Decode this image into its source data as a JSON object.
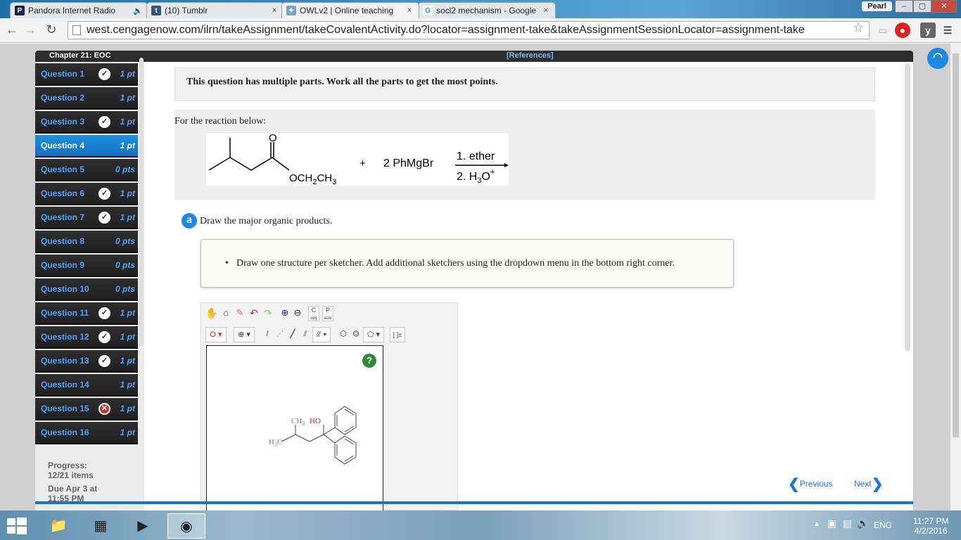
{
  "browser": {
    "tabs": [
      {
        "title": "Pandora Internet Radio",
        "icon": "P",
        "close": "×"
      },
      {
        "title": "(10) Tumblr",
        "icon": "t",
        "close": "×"
      },
      {
        "title": "OWLv2 | Online teaching",
        "icon": "owl",
        "close": "×"
      },
      {
        "title": "socl2 mechanism - Google",
        "icon": "G",
        "close": "×"
      }
    ],
    "profile": "Pearl",
    "url": "west.cengagenow.com/ilrn/takeAssignment/takeCovalentActivity.do?locator=assignment-take&takeAssignmentSessionLocator=assignment-take",
    "window_buttons": [
      "–",
      "▢",
      "✕"
    ]
  },
  "assignment": {
    "chapter": "Chapter 21: EOC",
    "references": "[References]",
    "questions": [
      {
        "label": "Question 1",
        "points": "1 pt",
        "status": "correct"
      },
      {
        "label": "Question 2",
        "points": "1 pt",
        "status": "none"
      },
      {
        "label": "Question 3",
        "points": "1 pt",
        "status": "correct"
      },
      {
        "label": "Question 4",
        "points": "1 pt",
        "status": "active"
      },
      {
        "label": "Question 5",
        "points": "0 pts",
        "status": "none"
      },
      {
        "label": "Question 6",
        "points": "1 pt",
        "status": "correct"
      },
      {
        "label": "Question 7",
        "points": "1 pt",
        "status": "correct"
      },
      {
        "label": "Question 8",
        "points": "0 pts",
        "status": "none"
      },
      {
        "label": "Question 9",
        "points": "0 pts",
        "status": "none"
      },
      {
        "label": "Question 10",
        "points": "0 pts",
        "status": "none"
      },
      {
        "label": "Question 11",
        "points": "1 pt",
        "status": "correct"
      },
      {
        "label": "Question 12",
        "points": "1 pt",
        "status": "correct"
      },
      {
        "label": "Question 13",
        "points": "1 pt",
        "status": "correct"
      },
      {
        "label": "Question 14",
        "points": "1 pt",
        "status": "none"
      },
      {
        "label": "Question 15",
        "points": "1 pt",
        "status": "incorrect"
      },
      {
        "label": "Question 16",
        "points": "1 pt",
        "status": "none"
      }
    ],
    "progress_label": "Progress:",
    "progress_value": "12/21 items",
    "due_line1": "Due Apr 3 at",
    "due_line2": "11:55 PM"
  },
  "question": {
    "multipart_note": "This question has multiple parts. Work all the parts to get the most points.",
    "for_reaction": "For the reaction below:",
    "reaction": {
      "substituent": "OCH",
      "substituent_sub": "2",
      "substituent_end": "CH",
      "substituent_sub2": "3",
      "oxygen": "O",
      "plus": "+",
      "reagent": "2 PhMgBr",
      "step1": "1. ether",
      "step2": "2. H",
      "step2_sub": "3",
      "step2_end": "O",
      "step2_sup": "+"
    },
    "part_label": "a",
    "part_prompt": "Draw the major organic products.",
    "instruction": "Draw one structure per sketcher. Add additional sketchers using the dropdown menu in the bottom right corner.",
    "bullet": "•"
  },
  "sketcher": {
    "help": "?",
    "tools": [
      "hand",
      "lasso",
      "eraser",
      "undo",
      "redo",
      "zoom-in",
      "zoom-out",
      "copy",
      "paste"
    ],
    "copy_label": "C",
    "copy_sub": "opy",
    "paste_label": "P",
    "paste_sub": "aste",
    "atom_label": "O",
    "charge_label": "⊕",
    "bracket_label": "[ ]±",
    "drawing": {
      "ch3": "CH",
      "ch3_sub": "3",
      "ho": "HO",
      "h3c": "H",
      "h3c_sub": "3",
      "h3c_end": "C"
    }
  },
  "navigation": {
    "previous": "Previous",
    "next": "Next"
  },
  "taskbar": {
    "language": "ENG",
    "time": "11:27 PM",
    "date": "4/2/2016"
  },
  "colors": {
    "accent": "#1e88e5",
    "sidebar_bg": "#2a2a2a",
    "question_link": "#4da3ff",
    "active_question": "#1a80d4"
  }
}
